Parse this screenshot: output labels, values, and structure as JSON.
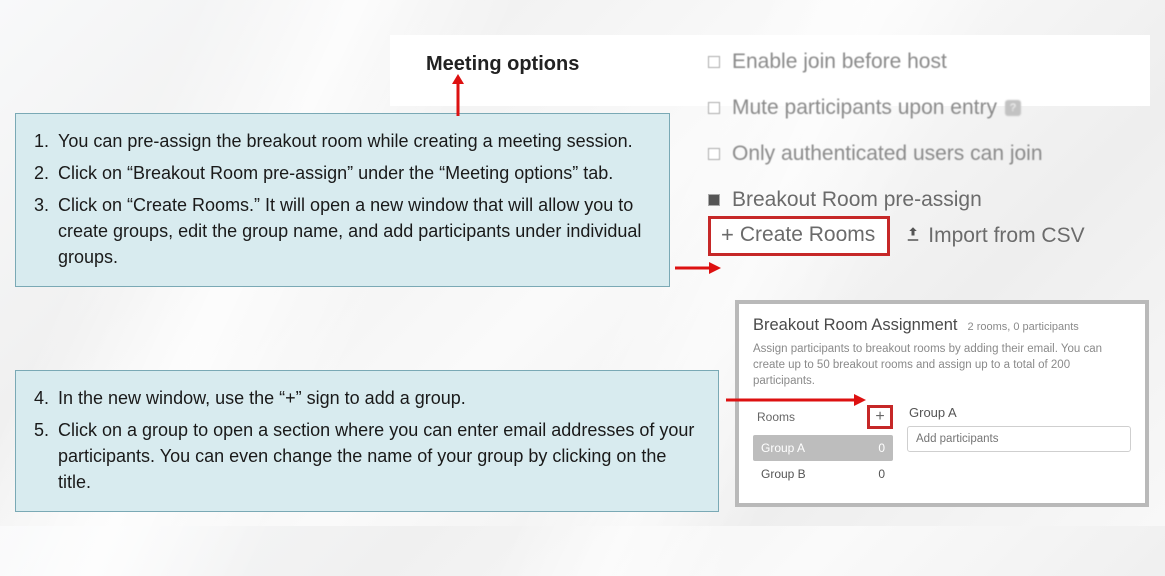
{
  "callouts": {
    "a": {
      "items": [
        {
          "n": "1.",
          "t": "You can pre-assign the breakout room while creating a meeting session."
        },
        {
          "n": "2.",
          "t": "Click on “Breakout Room pre-assign” under the “Meeting options” tab."
        },
        {
          "n": "3.",
          "t": "Click on “Create Rooms.” It will open a new window that will allow you to create groups, edit the group name, and add participants under individual groups."
        }
      ]
    },
    "b": {
      "items": [
        {
          "n": "4.",
          "t": "In the new window, use the “+” sign to add a group."
        },
        {
          "n": "5.",
          "t": "Click on a group to open a section where you can enter email addresses of your participants. You can even change the name of your group by clicking on the title."
        }
      ]
    }
  },
  "meeting": {
    "title": "Meeting options",
    "opts": {
      "join": "Enable join before host",
      "mute": "Mute participants upon entry",
      "auth": "Only authenticated users can join",
      "breakout": "Breakout Room pre-assign"
    },
    "create_label": "Create Rooms",
    "import_label": "Import from CSV"
  },
  "dialog": {
    "title": "Breakout Room Assignment",
    "subtitle": "2 rooms, 0 participants",
    "desc": "Assign participants to breakout rooms by adding their email. You can create up to 50 breakout rooms and assign up to a total of 200 participants.",
    "rooms_header": "Rooms",
    "rooms": [
      {
        "name": "Group A",
        "count": "0",
        "active": true
      },
      {
        "name": "Group B",
        "count": "0",
        "active": false
      }
    ],
    "selected_group": "Group A",
    "add_placeholder": "Add participants"
  }
}
